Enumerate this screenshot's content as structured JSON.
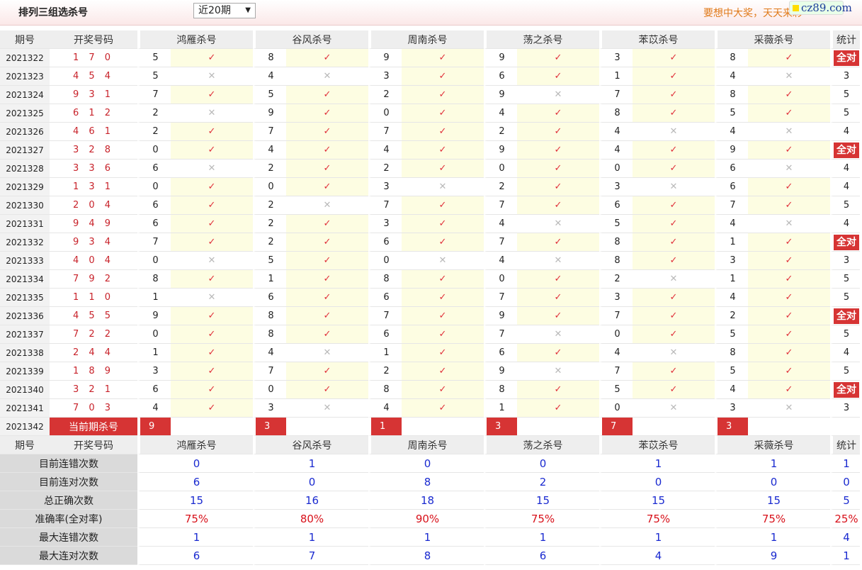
{
  "header": {
    "title": "排列三组选杀号",
    "period_select": "近20期",
    "promo": "要想中大奖，天天来彩",
    "logo": "cz89.com"
  },
  "table": {
    "headers": [
      "期号",
      "开奖号码",
      "鸿雁杀号",
      "谷风杀号",
      "周南杀号",
      "荡之杀号",
      "苯苡杀号",
      "采薇杀号",
      "统计"
    ],
    "all_right_label": "全对",
    "ok_mark": "✓",
    "bad_mark": "✕",
    "rows": [
      {
        "period": "2021322",
        "draw": "1 7 0",
        "picks": [
          [
            5,
            true
          ],
          [
            8,
            true
          ],
          [
            9,
            true
          ],
          [
            9,
            true
          ],
          [
            3,
            true
          ],
          [
            8,
            true
          ]
        ],
        "stat": "全对"
      },
      {
        "period": "2021323",
        "draw": "4 5 4",
        "picks": [
          [
            5,
            false
          ],
          [
            4,
            false
          ],
          [
            3,
            true
          ],
          [
            6,
            true
          ],
          [
            1,
            true
          ],
          [
            4,
            false
          ]
        ],
        "stat": "3"
      },
      {
        "period": "2021324",
        "draw": "9 3 1",
        "picks": [
          [
            7,
            true
          ],
          [
            5,
            true
          ],
          [
            2,
            true
          ],
          [
            9,
            false
          ],
          [
            7,
            true
          ],
          [
            8,
            true
          ]
        ],
        "stat": "5"
      },
      {
        "period": "2021325",
        "draw": "6 1 2",
        "picks": [
          [
            2,
            false
          ],
          [
            9,
            true
          ],
          [
            0,
            true
          ],
          [
            4,
            true
          ],
          [
            8,
            true
          ],
          [
            5,
            true
          ]
        ],
        "stat": "5"
      },
      {
        "period": "2021326",
        "draw": "4 6 1",
        "picks": [
          [
            2,
            true
          ],
          [
            7,
            true
          ],
          [
            7,
            true
          ],
          [
            2,
            true
          ],
          [
            4,
            false
          ],
          [
            4,
            false
          ]
        ],
        "stat": "4"
      },
      {
        "period": "2021327",
        "draw": "3 2 8",
        "picks": [
          [
            0,
            true
          ],
          [
            4,
            true
          ],
          [
            4,
            true
          ],
          [
            9,
            true
          ],
          [
            4,
            true
          ],
          [
            9,
            true
          ]
        ],
        "stat": "全对"
      },
      {
        "period": "2021328",
        "draw": "3 3 6",
        "picks": [
          [
            6,
            false
          ],
          [
            2,
            true
          ],
          [
            2,
            true
          ],
          [
            0,
            true
          ],
          [
            0,
            true
          ],
          [
            6,
            false
          ]
        ],
        "stat": "4"
      },
      {
        "period": "2021329",
        "draw": "1 3 1",
        "picks": [
          [
            0,
            true
          ],
          [
            0,
            true
          ],
          [
            3,
            false
          ],
          [
            2,
            true
          ],
          [
            3,
            false
          ],
          [
            6,
            true
          ]
        ],
        "stat": "4"
      },
      {
        "period": "2021330",
        "draw": "2 0 4",
        "picks": [
          [
            6,
            true
          ],
          [
            2,
            false
          ],
          [
            7,
            true
          ],
          [
            7,
            true
          ],
          [
            6,
            true
          ],
          [
            7,
            true
          ]
        ],
        "stat": "5"
      },
      {
        "period": "2021331",
        "draw": "9 4 9",
        "picks": [
          [
            6,
            true
          ],
          [
            2,
            true
          ],
          [
            3,
            true
          ],
          [
            4,
            false
          ],
          [
            5,
            true
          ],
          [
            4,
            false
          ]
        ],
        "stat": "4"
      },
      {
        "period": "2021332",
        "draw": "9 3 4",
        "picks": [
          [
            7,
            true
          ],
          [
            2,
            true
          ],
          [
            6,
            true
          ],
          [
            7,
            true
          ],
          [
            8,
            true
          ],
          [
            1,
            true
          ]
        ],
        "stat": "全对"
      },
      {
        "period": "2021333",
        "draw": "4 0 4",
        "picks": [
          [
            0,
            false
          ],
          [
            5,
            true
          ],
          [
            0,
            false
          ],
          [
            4,
            false
          ],
          [
            8,
            true
          ],
          [
            3,
            true
          ]
        ],
        "stat": "3"
      },
      {
        "period": "2021334",
        "draw": "7 9 2",
        "picks": [
          [
            8,
            true
          ],
          [
            1,
            true
          ],
          [
            8,
            true
          ],
          [
            0,
            true
          ],
          [
            2,
            false
          ],
          [
            1,
            true
          ]
        ],
        "stat": "5"
      },
      {
        "period": "2021335",
        "draw": "1 1 0",
        "picks": [
          [
            1,
            false
          ],
          [
            6,
            true
          ],
          [
            6,
            true
          ],
          [
            7,
            true
          ],
          [
            3,
            true
          ],
          [
            4,
            true
          ]
        ],
        "stat": "5"
      },
      {
        "period": "2021336",
        "draw": "4 5 5",
        "picks": [
          [
            9,
            true
          ],
          [
            8,
            true
          ],
          [
            7,
            true
          ],
          [
            9,
            true
          ],
          [
            7,
            true
          ],
          [
            2,
            true
          ]
        ],
        "stat": "全对"
      },
      {
        "period": "2021337",
        "draw": "7 2 2",
        "picks": [
          [
            0,
            true
          ],
          [
            8,
            true
          ],
          [
            6,
            true
          ],
          [
            7,
            false
          ],
          [
            0,
            true
          ],
          [
            5,
            true
          ]
        ],
        "stat": "5"
      },
      {
        "period": "2021338",
        "draw": "2 4 4",
        "picks": [
          [
            1,
            true
          ],
          [
            4,
            false
          ],
          [
            1,
            true
          ],
          [
            6,
            true
          ],
          [
            4,
            false
          ],
          [
            8,
            true
          ]
        ],
        "stat": "4"
      },
      {
        "period": "2021339",
        "draw": "1 8 9",
        "picks": [
          [
            3,
            true
          ],
          [
            7,
            true
          ],
          [
            2,
            true
          ],
          [
            9,
            false
          ],
          [
            7,
            true
          ],
          [
            5,
            true
          ]
        ],
        "stat": "5"
      },
      {
        "period": "2021340",
        "draw": "3 2 1",
        "picks": [
          [
            6,
            true
          ],
          [
            0,
            true
          ],
          [
            8,
            true
          ],
          [
            8,
            true
          ],
          [
            5,
            true
          ],
          [
            4,
            true
          ]
        ],
        "stat": "全对"
      },
      {
        "period": "2021341",
        "draw": "7 0 3",
        "picks": [
          [
            4,
            true
          ],
          [
            3,
            false
          ],
          [
            4,
            true
          ],
          [
            1,
            true
          ],
          [
            0,
            false
          ],
          [
            3,
            false
          ]
        ],
        "stat": "3"
      }
    ],
    "current": {
      "period": "2021342",
      "label": "当前期杀号",
      "picks": [
        9,
        3,
        1,
        3,
        7,
        3
      ]
    }
  },
  "summary": {
    "rows": [
      {
        "label": "目前连错次数",
        "values": [
          "0",
          "1",
          "0",
          "0",
          "1",
          "1"
        ],
        "stat": "1",
        "color": "blue"
      },
      {
        "label": "目前连对次数",
        "values": [
          "6",
          "0",
          "8",
          "2",
          "0",
          "0"
        ],
        "stat": "0",
        "color": "blue"
      },
      {
        "label": "总正确次数",
        "values": [
          "15",
          "16",
          "18",
          "15",
          "15",
          "15"
        ],
        "stat": "5",
        "color": "blue"
      },
      {
        "label": "准确率(全对率)",
        "values": [
          "75%",
          "80%",
          "90%",
          "75%",
          "75%",
          "75%"
        ],
        "stat": "25%",
        "color": "red"
      },
      {
        "label": "最大连错次数",
        "values": [
          "1",
          "1",
          "1",
          "1",
          "1",
          "1"
        ],
        "stat": "4",
        "color": "blue"
      },
      {
        "label": "最大连对次数",
        "values": [
          "6",
          "7",
          "8",
          "6",
          "4",
          "9"
        ],
        "stat": "1",
        "color": "blue"
      }
    ]
  },
  "colors": {
    "accent_red": "#d63434",
    "draw_red": "#c8222a",
    "ok_bg": "#fdfde2",
    "blue_value": "#1a2ad0"
  }
}
